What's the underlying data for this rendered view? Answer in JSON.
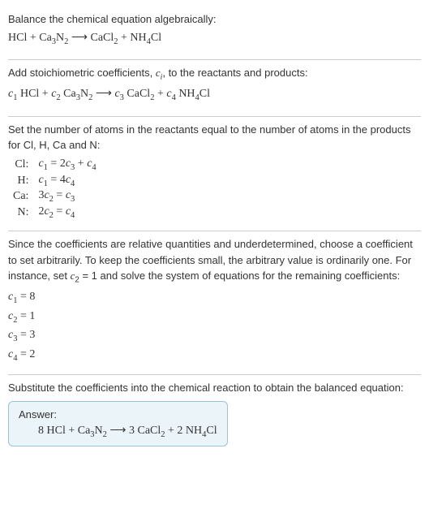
{
  "section1": {
    "text1": "Balance the chemical equation algebraically:",
    "eq_lhs1": "HCl + Ca",
    "eq_sub1": "3",
    "eq_lhs2": "N",
    "eq_sub2": "2",
    "eq_arrow": "  ⟶  ",
    "eq_rhs1": "CaCl",
    "eq_sub3": "2",
    "eq_rhs2": " + NH",
    "eq_sub4": "4",
    "eq_rhs3": "Cl"
  },
  "section2": {
    "text1": "Add stoichiometric coefficients, ",
    "ci": "c",
    "ci_sub": "i",
    "text2": ", to the reactants and products:",
    "c1": "c",
    "c1s": "1",
    "sp1": " HCl + ",
    "c2": "c",
    "c2s": "2",
    "sp2": " Ca",
    "s3": "3",
    "sp3": "N",
    "s4": "2",
    "arrow": "  ⟶  ",
    "c3": "c",
    "c3s": "3",
    "sp5": " CaCl",
    "s5": "2",
    "sp6": " + ",
    "c4": "c",
    "c4s": "4",
    "sp7": " NH",
    "s6": "4",
    "sp8": "Cl"
  },
  "section3": {
    "text1": "Set the number of atoms in the reactants equal to the number of atoms in the products for Cl, H, Ca and N:",
    "rows": [
      {
        "label": "Cl:",
        "c_a": "c",
        "s_a": "1",
        "mid1": " = 2",
        "c_b": "c",
        "s_b": "3",
        "mid2": " + ",
        "c_c": "c",
        "s_c": "4",
        "tail": ""
      },
      {
        "label": "H:",
        "c_a": "c",
        "s_a": "1",
        "mid1": " = 4",
        "c_b": "c",
        "s_b": "4",
        "mid2": "",
        "c_c": "",
        "s_c": "",
        "tail": ""
      },
      {
        "label": "Ca:",
        "c_a": "",
        "s_a": "",
        "mid1": "3",
        "c_b": "c",
        "s_b": "2",
        "mid2": " = ",
        "c_c": "c",
        "s_c": "3",
        "tail": ""
      },
      {
        "label": "N:",
        "c_a": "",
        "s_a": "",
        "mid1": "2",
        "c_b": "c",
        "s_b": "2",
        "mid2": " = ",
        "c_c": "c",
        "s_c": "4",
        "tail": ""
      }
    ]
  },
  "section4": {
    "text1": "Since the coefficients are relative quantities and underdetermined, choose a coefficient to set arbitrarily. To keep the coefficients small, the arbitrary value is ordinarily one. For instance, set ",
    "cset": "c",
    "cset_s": "2",
    "text2": " = 1 and solve the system of equations for the remaining coefficients:",
    "lines": [
      {
        "c": "c",
        "s": "1",
        "v": " = 8"
      },
      {
        "c": "c",
        "s": "2",
        "v": " = 1"
      },
      {
        "c": "c",
        "s": "3",
        "v": " = 3"
      },
      {
        "c": "c",
        "s": "4",
        "v": " = 2"
      }
    ]
  },
  "section5": {
    "text1": "Substitute the coefficients into the chemical reaction to obtain the balanced equation:",
    "answer_label": "Answer:",
    "eq_p1": "8 HCl + Ca",
    "eq_s1": "3",
    "eq_p2": "N",
    "eq_s2": "2",
    "eq_arrow": "  ⟶  ",
    "eq_p3": "3 CaCl",
    "eq_s3": "2",
    "eq_p4": " + 2 NH",
    "eq_s4": "4",
    "eq_p5": "Cl"
  }
}
